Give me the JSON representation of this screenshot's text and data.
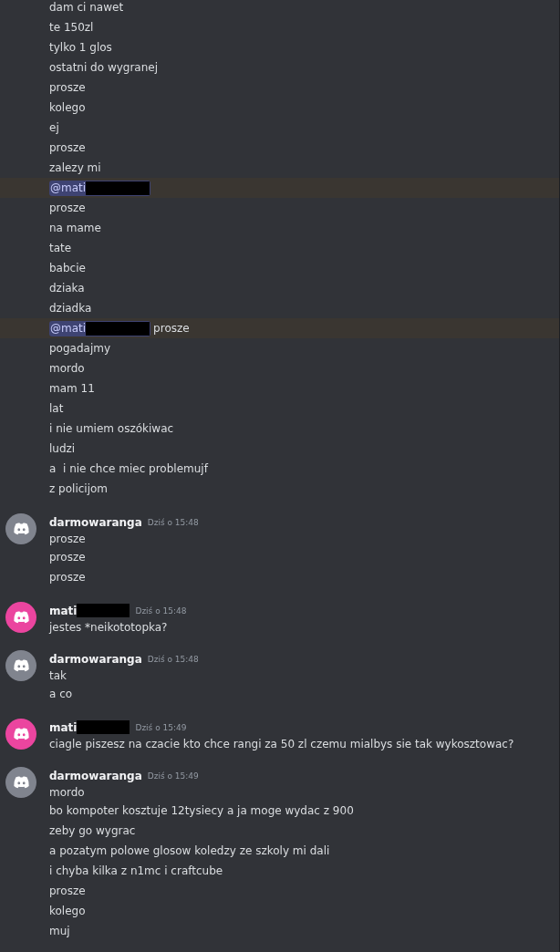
{
  "groups": [
    {
      "lines": [
        {
          "text": "dam ci nawet",
          "highlighted": false
        },
        {
          "text": "te 150zl",
          "highlighted": false
        },
        {
          "text": "tylko 1 glos",
          "highlighted": false
        },
        {
          "text": "ostatni do wygranej",
          "highlighted": false
        },
        {
          "text": "prosze",
          "highlighted": false
        },
        {
          "text": "kolego",
          "highlighted": false
        },
        {
          "text": "ej",
          "highlighted": false
        },
        {
          "text": "prosze",
          "highlighted": false
        },
        {
          "text": "zalezy mi",
          "highlighted": false
        },
        {
          "mention": {
            "text": "@mati",
            "redacted": true
          },
          "highlighted": true
        },
        {
          "text": "prosze",
          "highlighted": false
        },
        {
          "text": "na mame",
          "highlighted": false
        },
        {
          "text": "tate",
          "highlighted": false
        },
        {
          "text": "babcie",
          "highlighted": false
        },
        {
          "text": "dziaka",
          "highlighted": false
        },
        {
          "text": "dziadka",
          "highlighted": false
        },
        {
          "mention": {
            "text": "@mati",
            "redacted": true
          },
          "text": "prosze",
          "highlighted": true
        },
        {
          "text": "pogadajmy",
          "highlighted": false
        },
        {
          "text": "mordo",
          "highlighted": false
        },
        {
          "text": "mam 11",
          "highlighted": false
        },
        {
          "text": "lat",
          "highlighted": false
        },
        {
          "text": "i nie umiem oszókiwac",
          "highlighted": false
        },
        {
          "text": "ludzi",
          "highlighted": false
        },
        {
          "text": "a  i nie chce miec problemujf",
          "highlighted": false
        },
        {
          "text": "z policijom",
          "highlighted": false
        }
      ]
    },
    {
      "author": {
        "name": "darmowaranga",
        "redacted": false
      },
      "color": "#80848e",
      "time": "Dziś o 15:48",
      "lines": [
        {
          "text": "prosze",
          "highlighted": false
        },
        {
          "text": "prosze",
          "highlighted": false
        },
        {
          "text": "prosze",
          "highlighted": false
        }
      ]
    },
    {
      "author": {
        "name": "mati",
        "redacted": true
      },
      "color": "#eb459f",
      "time": "Dziś o 15:48",
      "lines": [
        {
          "text": "jestes *neikototopka?",
          "highlighted": false
        }
      ]
    },
    {
      "author": {
        "name": "darmowaranga",
        "redacted": false
      },
      "color": "#80848e",
      "time": "Dziś o 15:48",
      "lines": [
        {
          "text": "tak",
          "highlighted": false
        },
        {
          "text": "a co",
          "highlighted": false
        }
      ]
    },
    {
      "author": {
        "name": "mati",
        "redacted": true
      },
      "color": "#eb459f",
      "time": "Dziś o 15:49",
      "lines": [
        {
          "text": "ciagle piszesz na czacie kto chce rangi za 50 zl czemu mialbys sie tak wykosztowac?",
          "highlighted": false
        }
      ]
    },
    {
      "author": {
        "name": "darmowaranga",
        "redacted": false
      },
      "color": "#80848e",
      "time": "Dziś o 15:49",
      "lines": [
        {
          "text": "mordo",
          "highlighted": false
        },
        {
          "text": "bo kompoter kosztuje 12tysiecy a ja moge wydac z 900",
          "highlighted": false
        },
        {
          "text": "zeby go wygrac",
          "highlighted": false
        },
        {
          "text": "a pozatym polowe glosow koledzy ze szkoly mi dali",
          "highlighted": false
        },
        {
          "text": "i chyba kilka z n1mc i craftcube",
          "highlighted": false
        },
        {
          "text": "prosze",
          "highlighted": false
        },
        {
          "text": "kolego",
          "highlighted": false
        },
        {
          "text": "muj",
          "highlighted": false
        }
      ]
    }
  ]
}
